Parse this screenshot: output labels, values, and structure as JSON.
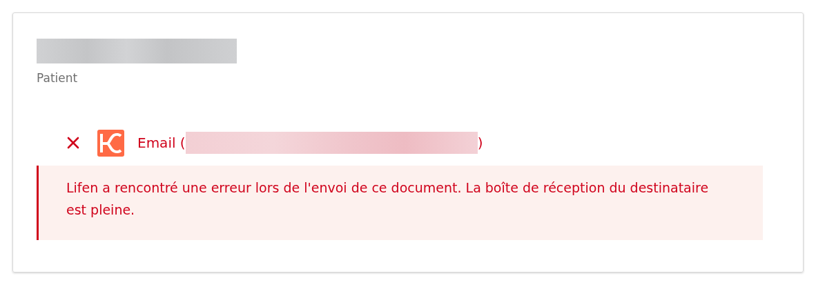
{
  "recipient": {
    "name_redacted": true,
    "role": "Patient"
  },
  "delivery": {
    "failed": true,
    "channel_prefix": "Email (",
    "address_redacted": true,
    "channel_suffix": ")"
  },
  "error": {
    "message": "Lifen a rencontré une erreur lors de l'envoi de ce document. La boîte de réception du destinataire est pleine."
  }
}
